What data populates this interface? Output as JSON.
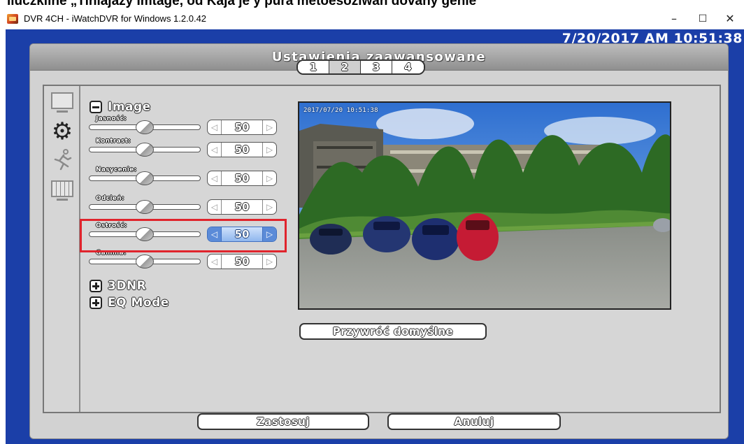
{
  "caption": {
    "text": "lluczkiine „Tiniajazy Imtage, od Kaja je y pura metoesoziwan dovany genie"
  },
  "window": {
    "title": "DVR 4CH - iWatchDVR for Windows 1.2.0.42",
    "minimize": "–",
    "maximize": "☐",
    "close": "✕"
  },
  "clock": "7/20/2017 AM 10:51:38",
  "panel": {
    "title": "Ustawienia zaawansowane"
  },
  "sidebar": {
    "icons": [
      "monitor-icon",
      "gear-icon",
      "running-person-icon",
      "grid-monitor-icon"
    ],
    "gear_glyph": "⚙",
    "run_glyph": "🏃"
  },
  "tabs": [
    "1",
    "2",
    "3",
    "4"
  ],
  "active_tab": "2",
  "image_section": {
    "label": "Image",
    "rows": [
      {
        "label": "Jasność:",
        "value": "50",
        "level": 0.5
      },
      {
        "label": "Kontrast:",
        "value": "50",
        "level": 0.5
      },
      {
        "label": "Nasycenie:",
        "value": "50",
        "level": 0.5
      },
      {
        "label": "Odcień:",
        "value": "50",
        "level": 0.5
      },
      {
        "label": "Ostrość:",
        "value": "50",
        "level": 0.5
      },
      {
        "label": "Gamma:",
        "value": "50",
        "level": 0.5
      }
    ]
  },
  "sections": {
    "dnr": "3DNR",
    "eq": "EQ Mode"
  },
  "preview": {
    "timestamp": "2017/07/20 10:51:38"
  },
  "buttons": {
    "restore": "Przywróć domyślne",
    "apply": "Zastosuj",
    "cancel": "Anuluj"
  },
  "colors": {
    "app_bg": "#1b3fa8",
    "panel_bg": "#d2d2d2",
    "highlight": "#e0242c",
    "spin_active": "#5b8bd8"
  },
  "arrows": {
    "left": "◁",
    "right": "▷"
  }
}
